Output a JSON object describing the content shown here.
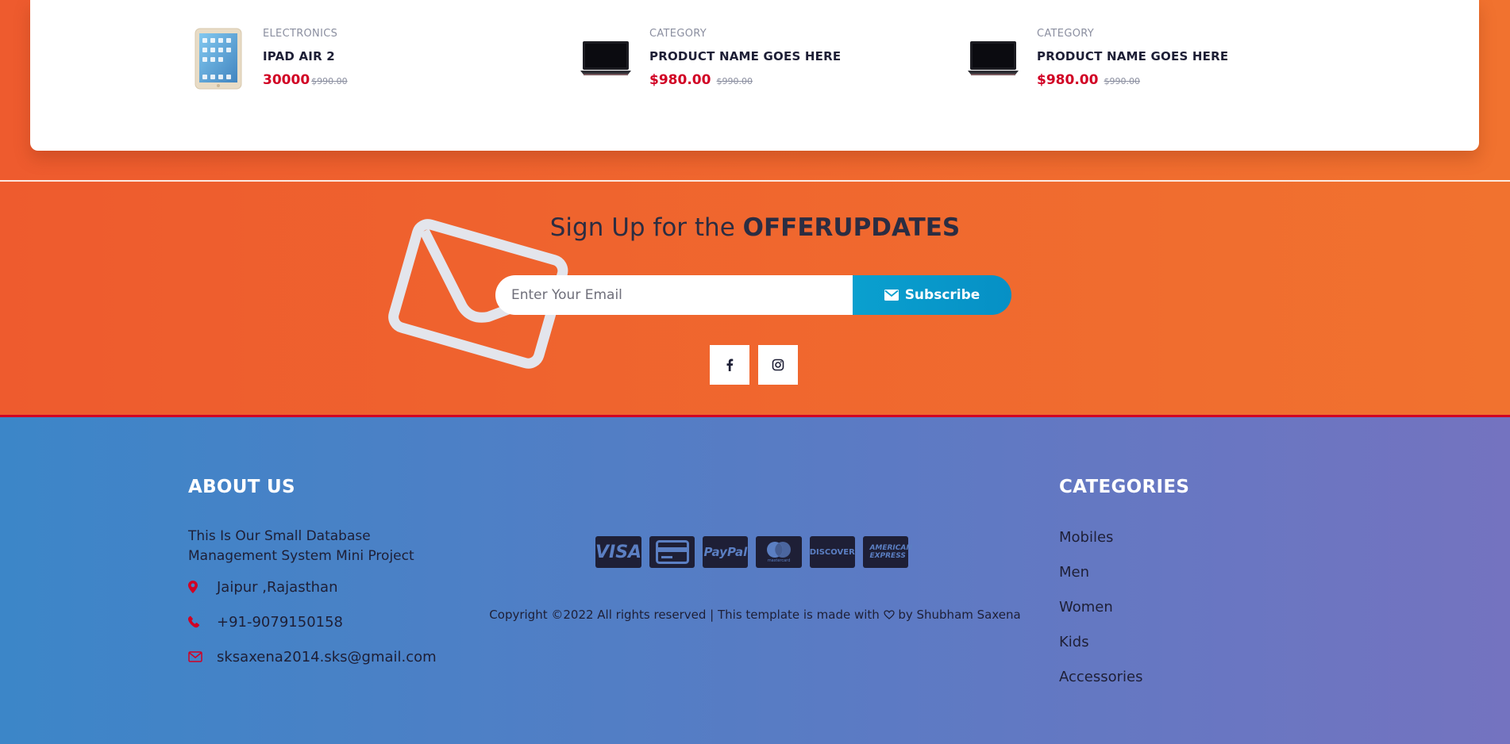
{
  "products": [
    {
      "category": "ELECTRONICS",
      "name": "IPAD AIR 2",
      "price": "30000",
      "old_price": "$990.00",
      "image": "ipad-image"
    },
    {
      "category": "CATEGORY",
      "name": "PRODUCT NAME GOES HERE",
      "price": "$980.00",
      "old_price": "$990.00",
      "image": "laptop-image"
    },
    {
      "category": "CATEGORY",
      "name": "PRODUCT NAME GOES HERE",
      "price": "$980.00",
      "old_price": "$990.00",
      "image": "laptop-image"
    }
  ],
  "newsletter": {
    "title_prefix": "Sign Up for the ",
    "title_bold": "OFFERUPDATES",
    "email_placeholder": "Enter Your Email",
    "subscribe_label": "Subscribe",
    "social": [
      {
        "icon": "facebook-icon"
      },
      {
        "icon": "instagram-icon"
      }
    ]
  },
  "footer": {
    "about": {
      "heading": "ABOUT US",
      "text": "This Is Our Small Database Management System Mini Project",
      "address": "Jaipur ,Rajasthan",
      "phone": "+91-9079150158",
      "email": "sksaxena2014.sks@gmail.com"
    },
    "payment_methods": [
      {
        "label": "VISA",
        "icon": "visa-icon"
      },
      {
        "label": "",
        "icon": "credit-card-icon"
      },
      {
        "label": "PayPal",
        "icon": "paypal-icon"
      },
      {
        "label": "mastercard",
        "icon": "mastercard-icon"
      },
      {
        "label": "DISCOVER",
        "icon": "discover-icon"
      },
      {
        "label": "AMERICAN EXPRESS",
        "icon": "amex-icon"
      }
    ],
    "copyright_prefix": "Copyright ©2022 All rights reserved | This template is made with ",
    "copyright_by": " by ",
    "copyright_author": "Shubham Saxena",
    "categories": {
      "heading": "CATEGORIES",
      "items": [
        "Mobiles",
        "Men",
        "Women",
        "Kids",
        "Accessories"
      ]
    }
  },
  "colors": {
    "accent_red": "#d10024",
    "subscribe_blue": "#0aa0cf",
    "dark_text": "#1e1f36"
  }
}
